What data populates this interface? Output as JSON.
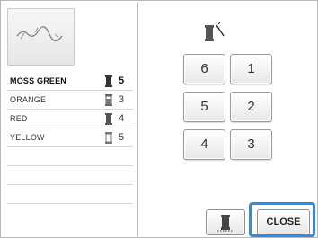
{
  "threads": [
    {
      "name": "MOSS GREEN",
      "count": "5",
      "selected": true,
      "spool": "filled"
    },
    {
      "name": "ORANGE",
      "count": "3",
      "selected": false,
      "spool": "partial"
    },
    {
      "name": "RED",
      "count": "4",
      "selected": false,
      "spool": "filled"
    },
    {
      "name": "YELLOW",
      "count": "5",
      "selected": false,
      "spool": "empty"
    }
  ],
  "needles": {
    "n6": "6",
    "n1": "1",
    "n5": "5",
    "n2": "2",
    "n4": "4",
    "n3": "3"
  },
  "buttons": {
    "close_label": "CLOSE",
    "spool_icon": "thread-spool-icon"
  },
  "icons": {
    "header": "spool-with-needle-icon",
    "preview": "embroidery-preview-icon"
  },
  "colors": {
    "highlight": "#2d8ce6",
    "spool": "#555555"
  }
}
